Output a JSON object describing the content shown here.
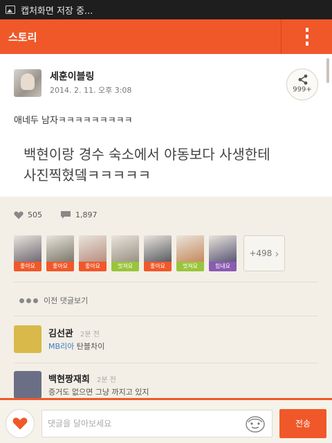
{
  "status_bar": {
    "text": "캡처화면 저장 중..."
  },
  "app_bar": {
    "title": "스토리"
  },
  "post": {
    "author": "세훈이블링",
    "date": "2014. 2. 11. 오후 3:08",
    "share_count": "999+",
    "text_1": "애네두 남자ㅋㅋㅋㅋㅋㅋㅋㅋㅋ",
    "text_2": "백현이랑 경수 숙소에서 야동보다 사생한테 사진찍혔뎈ㅋㅋㅋㅋㅋ"
  },
  "stats": {
    "likes": "505",
    "comments": "1,897"
  },
  "likers": [
    {
      "tag": "좋아요",
      "tag_color": "#f0582a",
      "pic_color": "#6f6a74"
    },
    {
      "tag": "좋아요",
      "tag_color": "#f0582a",
      "pic_color": "#7c786c"
    },
    {
      "tag": "좋아요",
      "tag_color": "#f0582a",
      "pic_color": "#b88f80"
    },
    {
      "tag": "멋져요",
      "tag_color": "#9ac43c",
      "pic_color": "#9a9184"
    },
    {
      "tag": "좋아요",
      "tag_color": "#f0582a",
      "pic_color": "#5a5d63"
    },
    {
      "tag": "멋져요",
      "tag_color": "#9ac43c",
      "pic_color": "#c58a5e"
    },
    {
      "tag": "힘내요",
      "tag_color": "#8a5bb1",
      "pic_color": "#5b5876"
    }
  ],
  "more_likers": "+498",
  "prev_comments_label": "이전 댓글보기",
  "comments": [
    {
      "name": "김선관",
      "time": "2분 전",
      "mention": "MB리아",
      "text": " 탄블차이",
      "avatar_color": "#d8b94a"
    },
    {
      "name": "백현짱재희",
      "time": "2분 전",
      "mention": "",
      "text": "증거도 없으면 그냥 까지고 있지",
      "avatar_color": "#6b6f86"
    }
  ],
  "input": {
    "placeholder": "댓글을 달아보세요"
  },
  "send_label": "전송",
  "colors": {
    "accent": "#f0582a",
    "background": "#f3efe6"
  }
}
